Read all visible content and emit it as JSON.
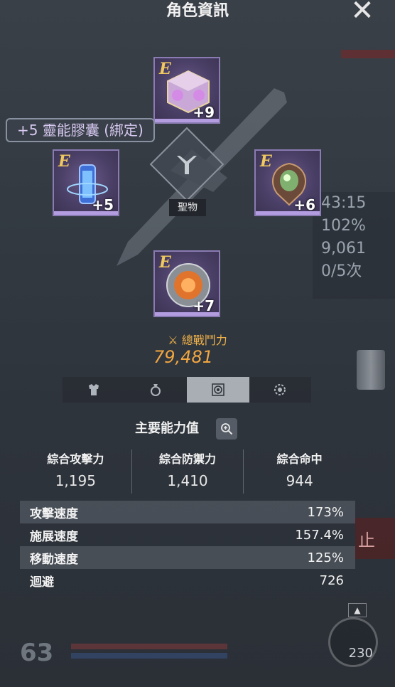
{
  "header": {
    "title": "角色資訊",
    "close_icon": "close-icon"
  },
  "equipment": {
    "tooltip": "+5 靈能膠囊 (綁定)",
    "center_label": "聖物",
    "slots": [
      {
        "grade": "E",
        "plus": "+9",
        "icon": "crystal-cube-icon"
      },
      {
        "grade": "E",
        "plus": "+5",
        "icon": "energy-capsule-icon"
      },
      {
        "grade": "E",
        "plus": "+6",
        "icon": "amulet-gem-icon"
      },
      {
        "grade": "E",
        "plus": "+7",
        "icon": "core-disc-icon"
      }
    ]
  },
  "power": {
    "label": "總戰鬥力",
    "value": "79,481"
  },
  "tabs": [
    {
      "icon": "armor-icon",
      "active": false
    },
    {
      "icon": "ring-icon",
      "active": false
    },
    {
      "icon": "relic-icon",
      "active": true
    },
    {
      "icon": "gear-icon",
      "active": false
    }
  ],
  "stats": {
    "heading": "主要能力值",
    "summary": [
      {
        "label": "綜合攻擊力",
        "value": "1,195"
      },
      {
        "label": "綜合防禦力",
        "value": "1,410"
      },
      {
        "label": "綜合命中",
        "value": "944"
      }
    ],
    "details": [
      {
        "label": "攻擊速度",
        "value": "173%"
      },
      {
        "label": "施展速度",
        "value": "157.4%"
      },
      {
        "label": "移動速度",
        "value": "125%"
      },
      {
        "label": "迴避",
        "value": "726"
      }
    ]
  },
  "background": {
    "panel_lines": [
      "43:15",
      "102%",
      "9,061",
      "0/5次"
    ],
    "stop_text": "止",
    "level_text": "63",
    "gauge_text": "230"
  }
}
